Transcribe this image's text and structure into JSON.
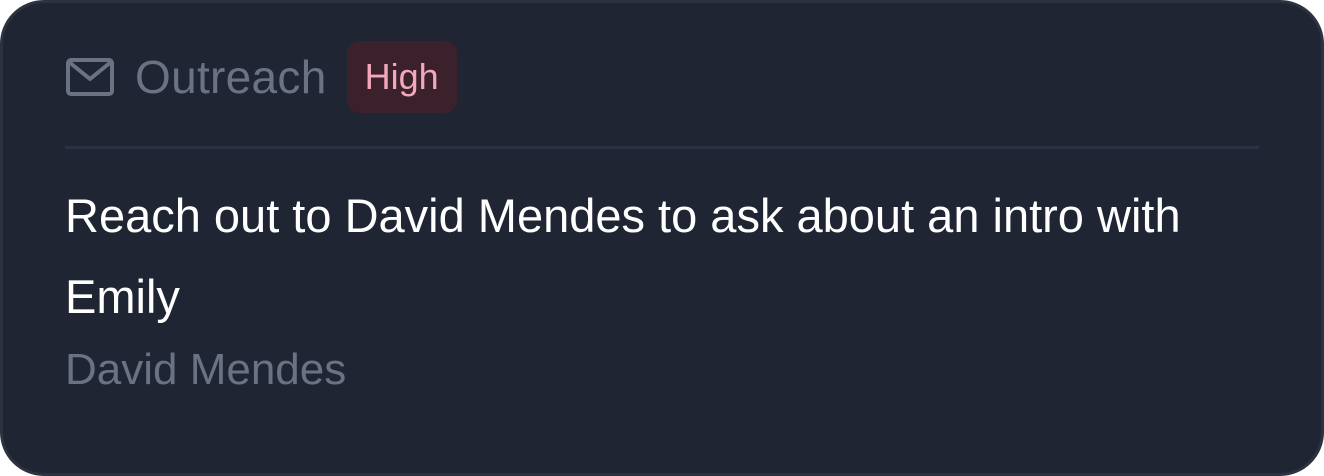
{
  "task": {
    "icon": "mail-icon",
    "category": "Outreach",
    "priority": "High",
    "title": "Reach out to David Mendes to ask about an intro with Emily",
    "assignee": "David Mendes"
  },
  "colors": {
    "card_background": "#1f2532",
    "muted_text": "#6b7382",
    "badge_background": "#3b212b",
    "badge_text": "#f3a7ba",
    "title_text": "#ffffff"
  }
}
